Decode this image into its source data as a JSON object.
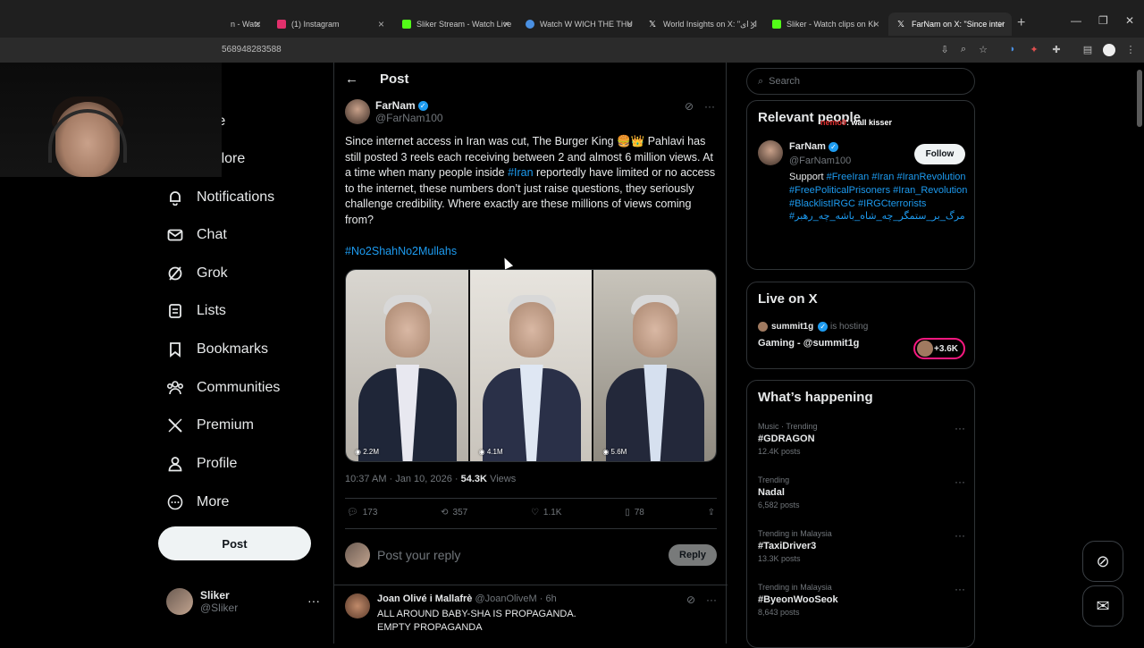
{
  "browser": {
    "tabs": [
      {
        "label": "n - Watc",
        "color": "#9146ff"
      },
      {
        "label": "(1) Instagram",
        "color": "#e1306c"
      },
      {
        "label": "Sliker Stream - Watch Live",
        "color": "#53fc18"
      },
      {
        "label": "Watch W WICH THE THU",
        "color": "#4a90e2"
      },
      {
        "label": "World Insights on X: \"از ای",
        "color": "#ffffff"
      },
      {
        "label": "Sliker - Watch clips on Ki",
        "color": "#53fc18"
      },
      {
        "label": "FarNam on X: \"Since inter",
        "color": "#ffffff"
      }
    ],
    "url": "568948283588"
  },
  "nav": {
    "home_partial": "me",
    "explore": "Explore",
    "notifications": "Notifications",
    "chat": "Chat",
    "grok": "Grok",
    "lists": "Lists",
    "bookmarks": "Bookmarks",
    "communities": "Communities",
    "premium": "Premium",
    "profile": "Profile",
    "more": "More",
    "post": "Post"
  },
  "account": {
    "name": "Sliker",
    "handle": "@Sliker"
  },
  "post": {
    "header": "Post",
    "author_name": "FarNam",
    "author_handle": "@FarNam100",
    "text_1": "Since internet access in Iran was cut, The Burger King 🍔👑 Pahlavi has still posted 3 reels each receiving between 2 and almost 6 million views. At a time when many people inside ",
    "text_link": "#Iran",
    "text_2": " reportedly have limited or no access to the internet, these numbers don’t just raise questions, they seriously challenge credibility. Where exactly are these millions of views coming from?",
    "hashtag": "#No2ShahNo2Mullahs",
    "media_views": [
      "2.2M",
      "4.1M",
      "5.6M"
    ],
    "timestamp": "10:37 AM · Jan 10, 2026 · ",
    "views_count": "54.3K",
    "views_label": "Views",
    "replies": "173",
    "reposts": "357",
    "likes": "1.1K",
    "bookmarks": "78",
    "reply_placeholder": "Post your reply",
    "reply_button": "Reply"
  },
  "reply": {
    "author_name": "Joan Olivé i Mallafrè",
    "author_handle": "@JoanOliveM",
    "time": "· 6h",
    "line1": "ALL AROUND BABY-SHA IS PROPAGANDA.",
    "line2": "EMPTY PROPAGANDA"
  },
  "right": {
    "search_placeholder": "Search",
    "relevant_title": "Relevant people",
    "overlay_user": "nemo9",
    "overlay_msg": ": wall kisser",
    "rp_name": "FarNam",
    "rp_handle": "@FarNam100",
    "follow": "Follow",
    "bio_prefix": "Support ",
    "bio_tags": "#FreeIran #Iran #IranRevolution #FreePoliticalPrisoners #Iran_Revolution #BlacklistIRGC #IRGCterrorists #مرگ_بر_ستمگر_چه_شاه_باشه_چه_رهبر",
    "live_title": "Live on X",
    "live_host": "summit1g",
    "live_hosting": "is hosting",
    "live_show": "Gaming - @summit1g",
    "live_count": "+3.6K",
    "happening_title": "What’s happening",
    "trends": [
      {
        "context": "Music · Trending",
        "title": "#GDRAGON",
        "count": "12.4K posts"
      },
      {
        "context": "Trending",
        "title": "Nadal",
        "count": "6,582 posts"
      },
      {
        "context": "Trending in Malaysia",
        "title": "#TaxiDriver3",
        "count": "13.3K posts"
      },
      {
        "context": "Trending in Malaysia",
        "title": "#ByeonWooSeok",
        "count": "8,643 posts"
      }
    ]
  }
}
